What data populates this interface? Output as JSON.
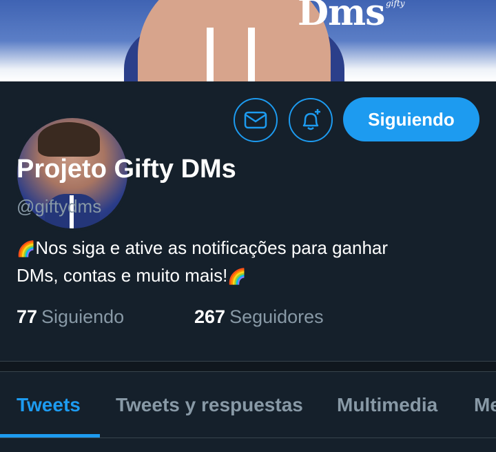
{
  "banner": {
    "text": "Dms",
    "small_text": "gifty"
  },
  "profile": {
    "name": "Projeto Gifty DMs",
    "handle": "@giftydms",
    "bio_line1": "Nos siga e ative as notificações para ganhar",
    "bio_line2": "DMs, contas e muito mais!",
    "rainbow_emoji": "🌈",
    "following_count": "77",
    "following_label": "Siguiendo",
    "followers_count": "267",
    "followers_label": "Seguidores"
  },
  "actions": {
    "dm_icon": "envelope-icon",
    "notif_icon": "bell-plus-icon",
    "follow_label": "Siguiendo"
  },
  "tabs": [
    {
      "label": "Tweets",
      "active": true
    },
    {
      "label": "Tweets y respuestas",
      "active": false
    },
    {
      "label": "Multimedia",
      "active": false
    },
    {
      "label": "Me",
      "active": false
    }
  ],
  "colors": {
    "background": "#15202b",
    "accent": "#1d9bf0",
    "secondary_text": "#8899a6"
  }
}
